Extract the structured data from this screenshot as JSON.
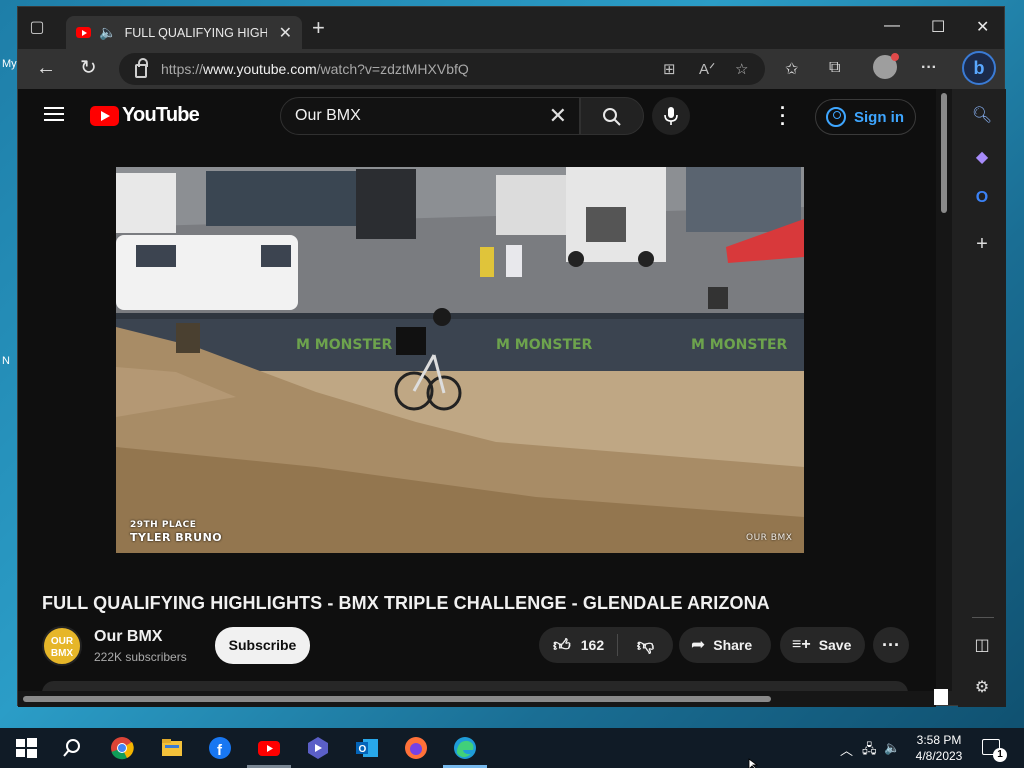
{
  "desktop": {
    "fragments": [
      "My",
      "N"
    ]
  },
  "browser": {
    "tab": {
      "title": "FULL QUALIFYING HIGHLIGHTS - BMX TRIPLE CHALLENGE - GLENDALE ARIZONA"
    },
    "address": {
      "scheme": "https://",
      "domain": "www.youtube.com",
      "path": "/watch?v=zdztMHXVbfQ"
    },
    "sidebar": {
      "icons": [
        "search-icon",
        "copilot-icon",
        "outlook-icon",
        "add-icon",
        "split-screen-icon",
        "settings-icon"
      ]
    }
  },
  "youtube": {
    "logo_text": "YouTube",
    "search": {
      "query": "Our BMX"
    },
    "signin_label": "Sign in",
    "video": {
      "overlay_rank": "29TH PLACE",
      "overlay_rider": "TYLER BRUNO",
      "watermark": "OUR BMX",
      "title": "FULL QUALIFYING HIGHLIGHTS - BMX TRIPLE CHALLENGE - GLENDALE ARIZONA"
    },
    "channel": {
      "avatar_text": "OUR BMX",
      "name": "Our BMX",
      "subscribers": "222K subscribers",
      "subscribe_label": "Subscribe"
    },
    "actions": {
      "likes": "162",
      "share_label": "Share",
      "save_label": "Save"
    }
  },
  "taskbar": {
    "apps": [
      "windows-start",
      "search",
      "chrome",
      "file-explorer",
      "facebook",
      "youtube",
      "app",
      "outlook",
      "firefox",
      "edge"
    ],
    "time": "3:58 PM",
    "date": "4/8/2023",
    "notification_count": "1"
  },
  "colors": {
    "youtube_red": "#ff0000",
    "link_blue": "#3ea6ff",
    "page_bg": "#0f0f0f",
    "desktop_bg": "#2b9dc7"
  }
}
